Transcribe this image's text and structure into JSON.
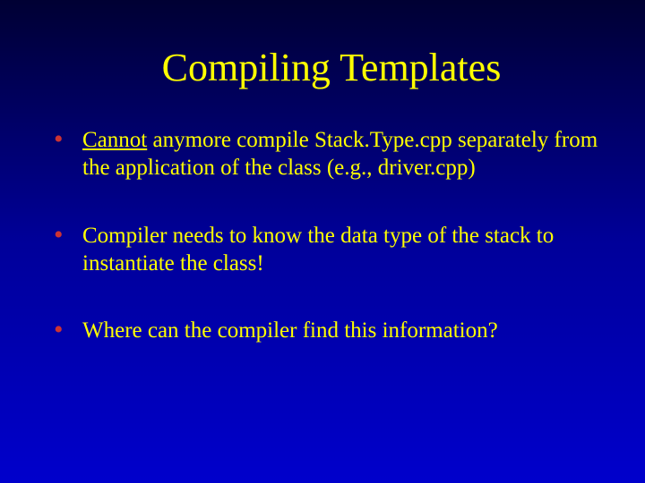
{
  "slide": {
    "title": "Compiling Templates",
    "bullets": [
      {
        "underlined": "Cannot",
        "rest": " anymore compile Stack.Type.cpp separately from the application of the class (e.g., driver.cpp)"
      },
      {
        "text": "Compiler needs to know the data type of the stack to instantiate the class!"
      },
      {
        "text": "Where can the compiler find this information?"
      }
    ]
  }
}
